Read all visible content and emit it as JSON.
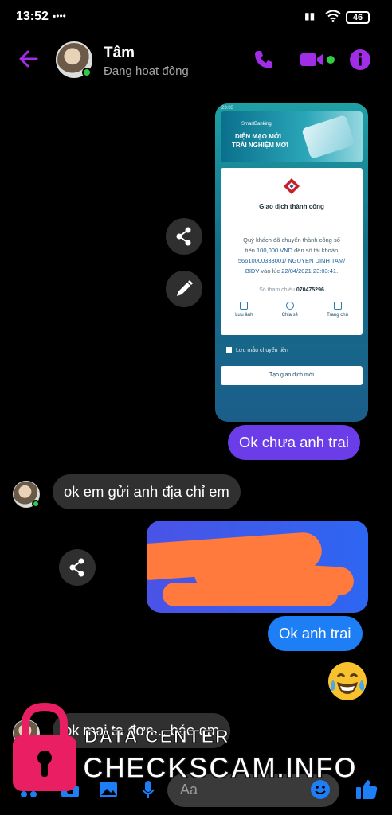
{
  "status_bar": {
    "time": "13:52",
    "battery": "46"
  },
  "header": {
    "name": "Tâm",
    "presence": "Đang hoạt động"
  },
  "colors": {
    "accent": "#a22de6",
    "outgoing_purple": "#6a3de8",
    "outgoing_blue": "#1e7ef5",
    "incoming": "#303030",
    "online": "#31cc46"
  },
  "shared_image": {
    "phone_time": "23:03",
    "brand": "SmartBanking",
    "banner_line1": "DIỆN MẠO MỚI",
    "banner_line2": "TRẢI NGHIỆM MỚI",
    "success_title": "Giao dịch thành công",
    "message_line1": "Quý khách đã chuyển thành công số",
    "message_line2_pre": "tiền",
    "amount": "100,000 VND",
    "message_line2_post": "đến số tài khoản",
    "account": "56610000333001/ NGUYEN DINH TAM/",
    "bank": "BIDV",
    "time_pre": "vào lúc",
    "datetime": "22/04/2021 23:03:41.",
    "ref_label": "Số tham chiếu",
    "ref_number": "070475296",
    "actions": [
      "Lưu ảnh",
      "Chia sẻ",
      "Trang chủ"
    ],
    "save_template": "Lưu mẫu chuyển tiền",
    "new_transaction": "Tạo giao dịch mới"
  },
  "messages": {
    "out1": "Ok chưa anh trai",
    "in1": "ok em gửi anh địa chỉ em",
    "out2": "Ok anh trai",
    "in2": "ok mai ta đơn... báo em"
  },
  "composer": {
    "placeholder": "Aa"
  },
  "watermark": {
    "line1": "DATA CENTER",
    "line2": "CHECKSCAM.INFO"
  }
}
